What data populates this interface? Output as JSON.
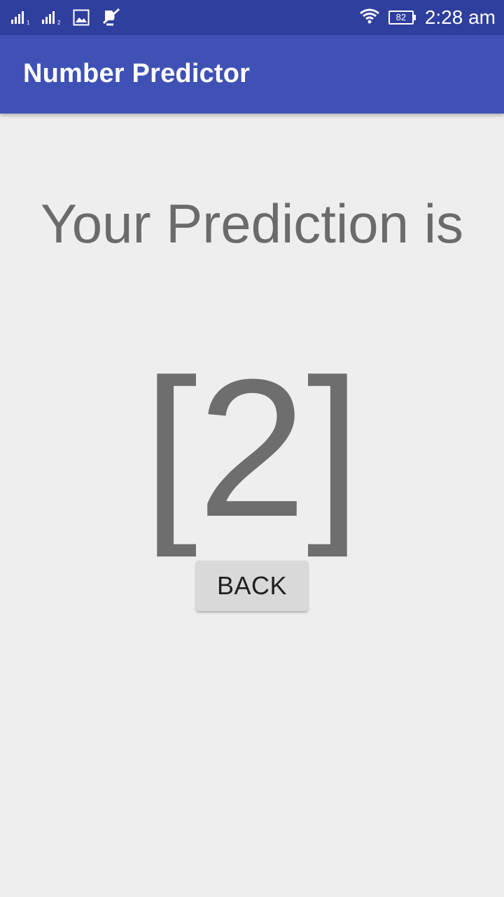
{
  "status_bar": {
    "icons_left": [
      "signal-sim1-icon",
      "signal-sim2-icon",
      "image-icon",
      "mute-icon"
    ],
    "wifi_icon": "wifi-icon",
    "battery_level": "82",
    "time": "2:28 am"
  },
  "app_bar": {
    "title": "Number Predictor"
  },
  "main": {
    "heading": "Your Prediction is",
    "prediction": "[2]",
    "back_label": "BACK"
  },
  "colors": {
    "status_bar": "#2f3f9e",
    "app_bar": "#3f51b5",
    "background": "#eeeeee",
    "text_gray": "#6b6b6b",
    "button_bg": "#d8d9d8"
  }
}
